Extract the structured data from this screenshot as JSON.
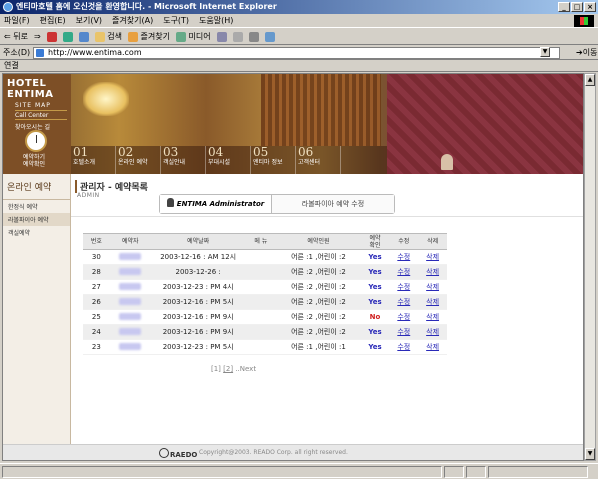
{
  "window": {
    "title": "엔티마호텔 홈에 오신것을 환영합니다. - Microsoft Internet Explorer"
  },
  "menu": [
    "파일(F)",
    "편집(E)",
    "보기(V)",
    "즐겨찾기(A)",
    "도구(T)",
    "도움말(H)"
  ],
  "toolbar": {
    "back": "뒤로",
    "search": "검색",
    "favorites": "즐겨찾기",
    "media": "미디어"
  },
  "address": {
    "label": "주소(D)",
    "url": "http://www.entima.com",
    "go": "이동"
  },
  "links": {
    "label": "연결"
  },
  "banner": {
    "logo_line1": "HOTEL",
    "logo_line2": "ENTIMA",
    "site_map": "SITE MAP",
    "call_center": "Call Center",
    "find_way": "찾아오시는 길",
    "reserve1": "예약하기",
    "reserve2": "예약확인",
    "nav": [
      {
        "num": "01",
        "label": "호텔소개"
      },
      {
        "num": "02",
        "label": "온라인 예약"
      },
      {
        "num": "03",
        "label": "객실안내"
      },
      {
        "num": "04",
        "label": "부대시설"
      },
      {
        "num": "05",
        "label": "엔티마 정보"
      },
      {
        "num": "06",
        "label": "고객센터"
      }
    ]
  },
  "sidebar": {
    "heading": "온라인 예약",
    "items": [
      "한정식 예약",
      "라볼파이아 예약",
      "객실예약"
    ]
  },
  "main": {
    "title": "관리자 - 예약목록",
    "subtitle": "ADMIN",
    "tab_active": "ENTIMA Administrator",
    "tab_inactive": "라볼파이아 예약 수정"
  },
  "table": {
    "headers": [
      "번호",
      "예약자",
      "예약날짜",
      "메 뉴",
      "예약인원",
      "예약\n확인",
      "수정",
      "삭제"
    ],
    "rows": [
      {
        "no": "30",
        "date": "2003-12-16 : AM 12시",
        "menu": "",
        "people": "어른 :1 ,어린이 :2",
        "confirm": "Yes",
        "edit": "수정",
        "del": "삭제"
      },
      {
        "no": "28",
        "date": "2003-12-26 :",
        "menu": "",
        "people": "어른 :2 ,어린이 :2",
        "confirm": "Yes",
        "edit": "수정",
        "del": "삭제"
      },
      {
        "no": "27",
        "date": "2003-12-23 : PM 4시",
        "menu": "",
        "people": "어른 :2 ,어린이 :2",
        "confirm": "Yes",
        "edit": "수정",
        "del": "삭제"
      },
      {
        "no": "26",
        "date": "2003-12-16 : PM 5시",
        "menu": "",
        "people": "어른 :2 ,어린이 :2",
        "confirm": "Yes",
        "edit": "수정",
        "del": "삭제"
      },
      {
        "no": "25",
        "date": "2003-12-16 : PM 9시",
        "menu": "",
        "people": "어른 :2 ,어린이 :2",
        "confirm": "No",
        "edit": "수정",
        "del": "삭제"
      },
      {
        "no": "24",
        "date": "2003-12-16 : PM 9시",
        "menu": "",
        "people": "어른 :2 ,어린이 :2",
        "confirm": "Yes",
        "edit": "수정",
        "del": "삭제"
      },
      {
        "no": "23",
        "date": "2003-12-23 : PM 5시",
        "menu": "",
        "people": "어른 :1 ,어린이 :1",
        "confirm": "Yes",
        "edit": "수정",
        "del": "삭제"
      }
    ]
  },
  "pager": {
    "p1": "[1]",
    "p2": "[2]",
    "next": "..Next"
  },
  "footer": {
    "logo": "RAEDO",
    "copyright": "Copyright@2003. READO Corp. all right reserved."
  }
}
